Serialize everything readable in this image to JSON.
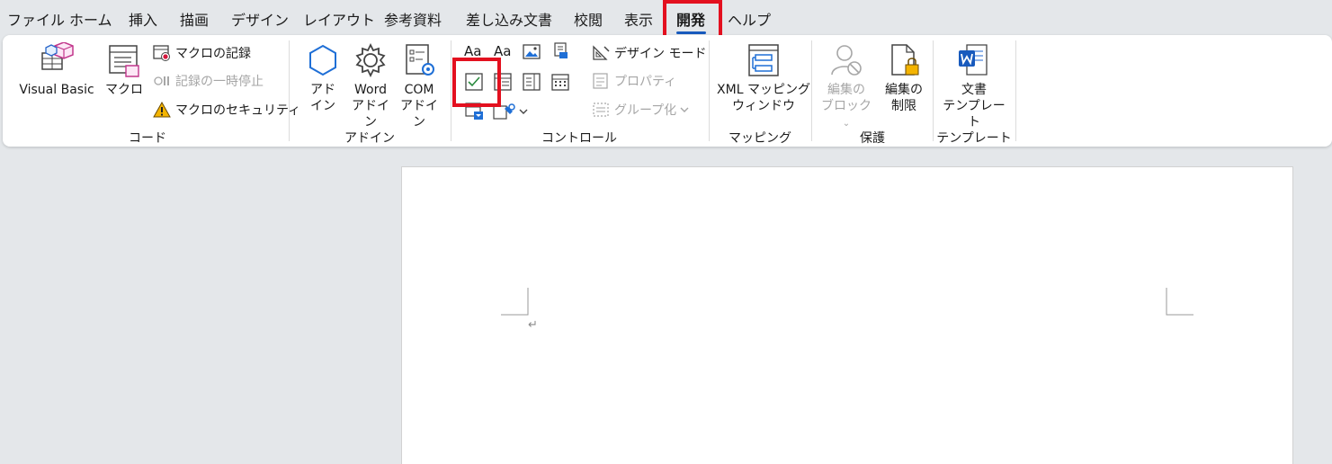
{
  "tabs": [
    {
      "label": "ファイル"
    },
    {
      "label": "ホーム"
    },
    {
      "label": "挿入"
    },
    {
      "label": "描画"
    },
    {
      "label": "デザイン"
    },
    {
      "label": "レイアウト"
    },
    {
      "label": "参考資料"
    },
    {
      "label": "差し込み文書"
    },
    {
      "label": "校閲"
    },
    {
      "label": "表示"
    },
    {
      "label": "開発"
    },
    {
      "label": "ヘルプ"
    }
  ],
  "active_tab": "開発",
  "colors": {
    "accent": "#185abd",
    "highlight": "#e3101f",
    "word_blue": "#185abd"
  },
  "code": {
    "visual_basic": "Visual Basic",
    "macro": "マクロ",
    "record_macro": "マクロの記録",
    "pause_recording": "記録の一時停止",
    "macro_security": "マクロのセキュリティ",
    "label": "コード"
  },
  "addins": {
    "addin_line1": "アド",
    "addin_line2": "イン",
    "word_line1": "Word",
    "word_line2": "アドイン",
    "com_line1": "COM",
    "com_line2": "アドイン",
    "label": "アドイン"
  },
  "controls": {
    "design_mode": "デザイン モード",
    "properties": "プロパティ",
    "group": "グループ化",
    "label": "コントロール",
    "rich_text_glyph": "Aa",
    "plain_text_glyph": "Aa"
  },
  "mapping": {
    "xml_line1": "XML マッピング",
    "xml_line2": "ウィンドウ",
    "label": "マッピング"
  },
  "protect": {
    "block_line1": "編集の",
    "block_line2": "ブロック",
    "restrict_line1": "編集の",
    "restrict_line2": "制限",
    "label": "保護"
  },
  "templates": {
    "doc_line1": "文書",
    "doc_line2": "テンプレート",
    "label": "テンプレート"
  },
  "document": {
    "paragraph_mark": "↵"
  }
}
